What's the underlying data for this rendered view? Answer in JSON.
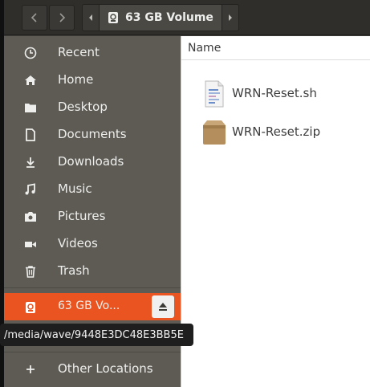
{
  "header": {
    "back_label": "",
    "forward_label": "",
    "path": "63 GB Volume"
  },
  "sidebar": {
    "items": [
      {
        "label": "Recent",
        "icon": "clock-icon"
      },
      {
        "label": "Home",
        "icon": "home-icon"
      },
      {
        "label": "Desktop",
        "icon": "folder-icon"
      },
      {
        "label": "Documents",
        "icon": "document-icon"
      },
      {
        "label": "Downloads",
        "icon": "download-icon"
      },
      {
        "label": "Music",
        "icon": "music-icon"
      },
      {
        "label": "Pictures",
        "icon": "camera-icon"
      },
      {
        "label": "Videos",
        "icon": "video-icon"
      },
      {
        "label": "Trash",
        "icon": "trash-icon"
      }
    ],
    "volume": {
      "label": "63 GB Vo...",
      "icon": "drive-icon",
      "eject_icon": "eject-icon"
    },
    "other": {
      "label": "Other Locations",
      "icon": "plus-icon"
    }
  },
  "main": {
    "column_name": "Name",
    "files": [
      {
        "name": "WRN-Reset.sh",
        "icon": "script-file-icon"
      },
      {
        "name": "WRN-Reset.zip",
        "icon": "archive-file-icon"
      }
    ]
  },
  "tooltip": {
    "text": "/media/wave/9448E3DC48E3BB5E"
  },
  "colors": {
    "accent": "#e95420",
    "sidebar": "#5d5b54",
    "header": "#2f2e2b"
  }
}
